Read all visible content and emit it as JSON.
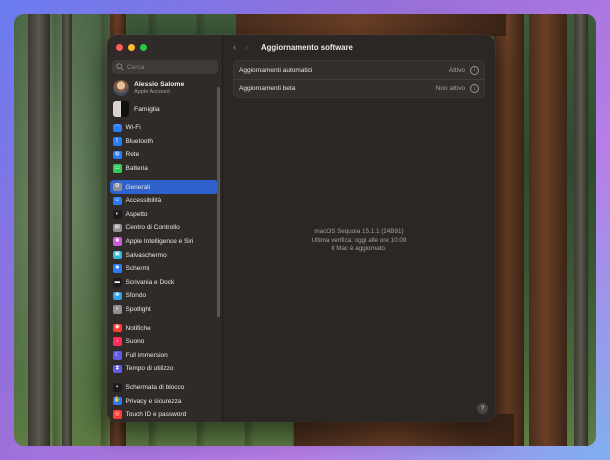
{
  "window": {
    "title": "Aggiornamento software"
  },
  "sidebar": {
    "search_placeholder": "Cerca",
    "account": {
      "name": "Alessio Salome",
      "subtitle": "Apple Account"
    },
    "family_label": "Famiglia",
    "groups": [
      [
        {
          "label": "Wi-Fi",
          "icon": "wifi-icon",
          "color": "#2a7cf6",
          "glyph": "◠"
        },
        {
          "label": "Bluetooth",
          "icon": "bluetooth-icon",
          "color": "#2a7cf6",
          "glyph": "ᛒ"
        },
        {
          "label": "Rete",
          "icon": "network-icon",
          "color": "#2a7cf6",
          "glyph": "◍"
        },
        {
          "label": "Batteria",
          "icon": "battery-icon",
          "color": "#34c759",
          "glyph": "▭"
        }
      ],
      [
        {
          "label": "Generali",
          "icon": "gear-icon",
          "color": "#8e8e93",
          "glyph": "⚙",
          "selected": true
        },
        {
          "label": "Accessibilità",
          "icon": "accessibility-icon",
          "color": "#2a7cf6",
          "glyph": "☺"
        },
        {
          "label": "Aspetto",
          "icon": "appearance-icon",
          "color": "#1c1c1e",
          "glyph": "◐"
        },
        {
          "label": "Centro di Controllo",
          "icon": "control-center-icon",
          "color": "#8e8e93",
          "glyph": "▤"
        },
        {
          "label": "Apple Intelligence e Siri",
          "icon": "siri-icon",
          "color": "#c85cd6",
          "glyph": "✺"
        },
        {
          "label": "Salvaschermo",
          "icon": "screensaver-icon",
          "color": "#39b6d8",
          "glyph": "▣"
        },
        {
          "label": "Schermi",
          "icon": "displays-icon",
          "color": "#2a7cf6",
          "glyph": "✹"
        },
        {
          "label": "Scrivania e Dock",
          "icon": "dock-icon",
          "color": "#1c1c1e",
          "glyph": "▬"
        },
        {
          "label": "Sfondo",
          "icon": "wallpaper-icon",
          "color": "#32a0e6",
          "glyph": "❀"
        },
        {
          "label": "Spotlight",
          "icon": "spotlight-icon",
          "color": "#8e8e93",
          "glyph": "⌕"
        }
      ],
      [
        {
          "label": "Notifiche",
          "icon": "notifications-icon",
          "color": "#ff3b30",
          "glyph": "◉"
        },
        {
          "label": "Suono",
          "icon": "sound-icon",
          "color": "#ff2d55",
          "glyph": "♪"
        },
        {
          "label": "Full immersion",
          "icon": "focus-icon",
          "color": "#5e5ce6",
          "glyph": "☾"
        },
        {
          "label": "Tempo di utilizzo",
          "icon": "screen-time-icon",
          "color": "#5e5ce6",
          "glyph": "⧗"
        }
      ],
      [
        {
          "label": "Schermata di blocco",
          "icon": "lock-screen-icon",
          "color": "#1c1c1e",
          "glyph": "▪"
        },
        {
          "label": "Privacy e sicurezza",
          "icon": "privacy-icon",
          "color": "#2a7cf6",
          "glyph": "✋"
        },
        {
          "label": "Touch ID e password",
          "icon": "touch-id-icon",
          "color": "#ff3b30",
          "glyph": "◎"
        }
      ]
    ]
  },
  "main": {
    "rows": [
      {
        "key": "Aggiornamenti automatici",
        "value": "Attivo"
      },
      {
        "key": "Aggiornamenti beta",
        "value": "Non attivo"
      }
    ],
    "status_lines": [
      "macOS Sequoia 15.1.1 (24B91)",
      "Ultima verifica: oggi alle ore 10:09",
      "Il Mac è aggiornato."
    ],
    "help_label": "?"
  }
}
